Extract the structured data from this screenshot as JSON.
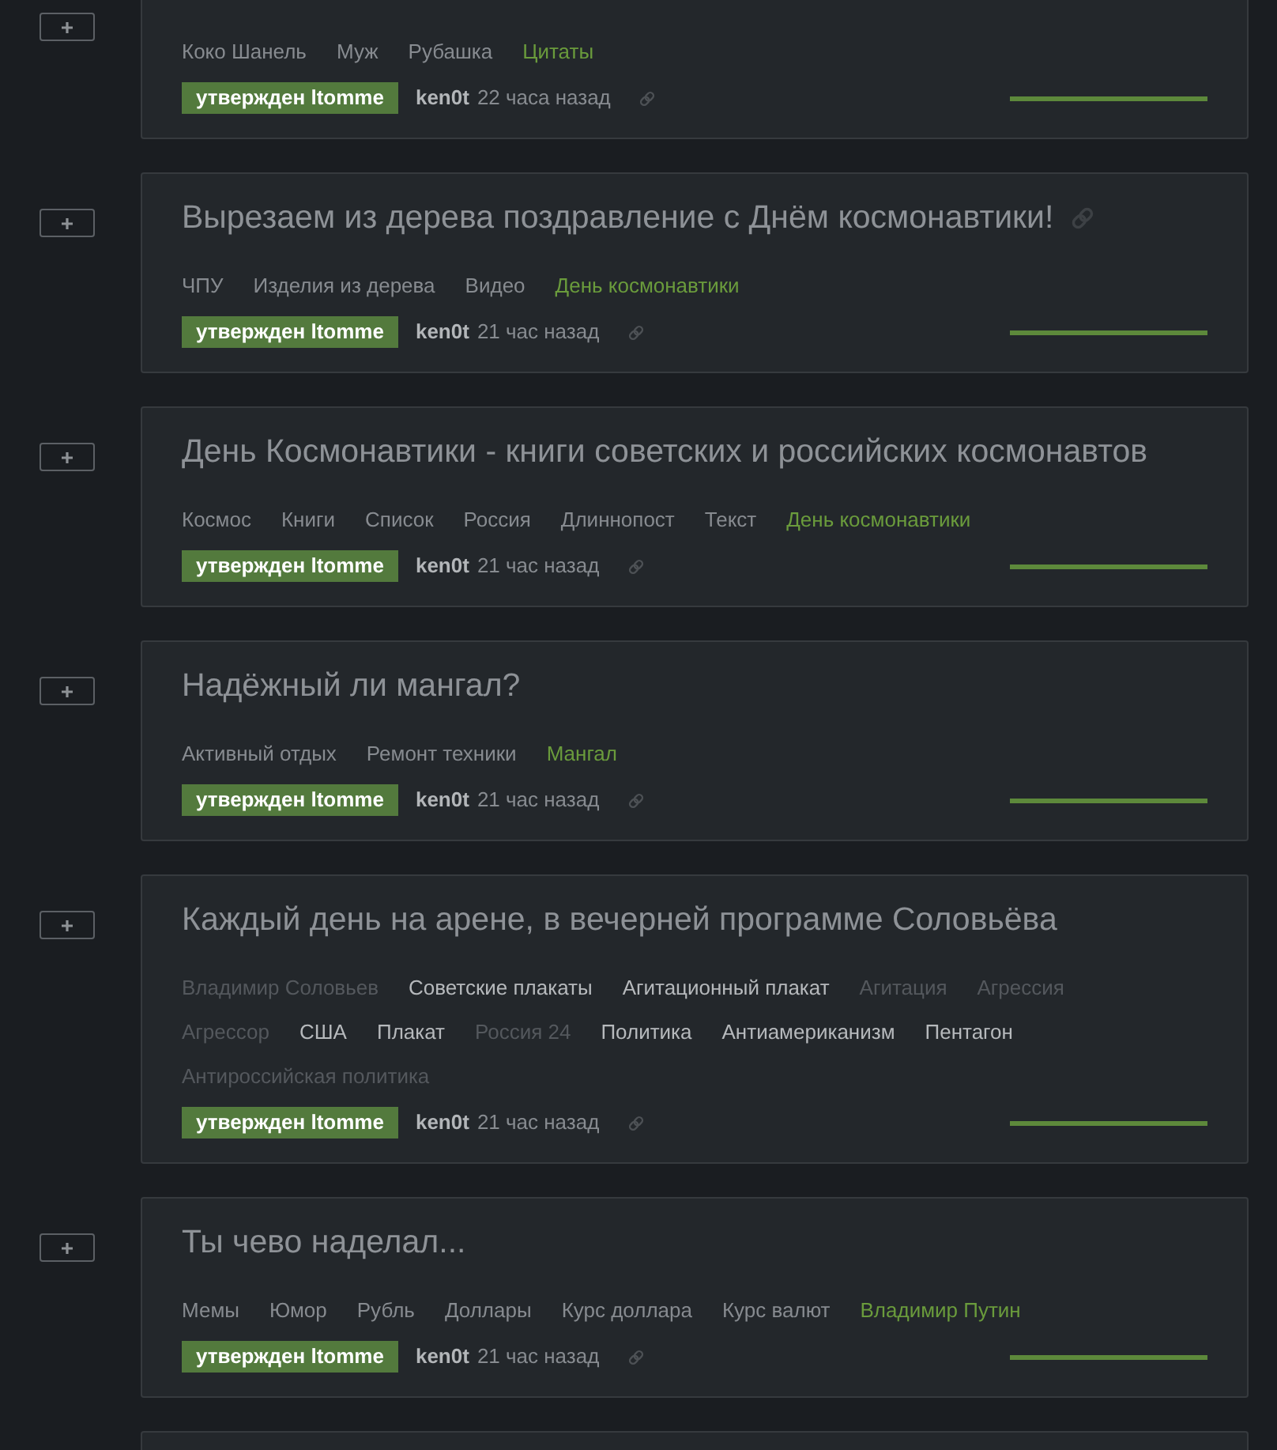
{
  "posts": [
    {
      "title_link_icon": false,
      "tags": [
        {
          "label": "Коко Шанель",
          "kind": "plain"
        },
        {
          "label": "Муж",
          "kind": "plain"
        },
        {
          "label": "Рубашка",
          "kind": "plain"
        },
        {
          "label": "Цитаты",
          "kind": "accent"
        }
      ],
      "badge": "утвержден ltomme",
      "author": "ken0t",
      "time": "22 часа назад",
      "rating": {
        "level": 1
      }
    },
    {
      "title": "Вырезаем из дерева поздравление с Днём космонавтики!",
      "title_link_icon": true,
      "tags": [
        {
          "label": "ЧПУ",
          "kind": "plain"
        },
        {
          "label": "Изделия из дерева",
          "kind": "plain"
        },
        {
          "label": "Видео",
          "kind": "plain"
        },
        {
          "label": "День космонавтики",
          "kind": "accent"
        }
      ],
      "badge": "утвержден ltomme",
      "author": "ken0t",
      "time": "21 час назад",
      "rating": {
        "level": 1
      }
    },
    {
      "title": "День Космонавтики - книги советских и российских космонавтов",
      "title_link_icon": false,
      "tags": [
        {
          "label": "Космос",
          "kind": "plain"
        },
        {
          "label": "Книги",
          "kind": "plain"
        },
        {
          "label": "Список",
          "kind": "plain"
        },
        {
          "label": "Россия",
          "kind": "plain"
        },
        {
          "label": "Длиннопост",
          "kind": "plain"
        },
        {
          "label": "Текст",
          "kind": "plain"
        },
        {
          "label": "День космонавтики",
          "kind": "accent"
        }
      ],
      "badge": "утвержден ltomme",
      "author": "ken0t",
      "time": "21 час назад",
      "rating": {
        "level": 1
      }
    },
    {
      "title": "Надёжный ли мангал?",
      "title_link_icon": false,
      "tags": [
        {
          "label": "Активный отдых",
          "kind": "plain"
        },
        {
          "label": "Ремонт техники",
          "kind": "plain"
        },
        {
          "label": "Мангал",
          "kind": "accent"
        }
      ],
      "badge": "утвержден ltomme",
      "author": "ken0t",
      "time": "21 час назад",
      "rating": {
        "level": 1
      }
    },
    {
      "title": "Каждый день на арене, в вечерней программе Соловьёва",
      "title_link_icon": false,
      "tags": [
        {
          "label": "Владимир Соловьев",
          "kind": "dim"
        },
        {
          "label": "Советские плакаты",
          "kind": "bright"
        },
        {
          "label": "Агитационный плакат",
          "kind": "bright"
        },
        {
          "label": "Агитация",
          "kind": "dim"
        },
        {
          "label": "Агрессия",
          "kind": "dim"
        },
        {
          "label": "Агрессор",
          "kind": "dim"
        },
        {
          "label": "США",
          "kind": "bright"
        },
        {
          "label": "Плакат",
          "kind": "bright"
        },
        {
          "label": "Россия 24",
          "kind": "dim"
        },
        {
          "label": "Политика",
          "kind": "bright"
        },
        {
          "label": "Антиамериканизм",
          "kind": "bright"
        },
        {
          "label": "Пентагон",
          "kind": "bright"
        },
        {
          "label": "Антироссийская политика",
          "kind": "dim"
        }
      ],
      "badge": "утвержден ltomme",
      "author": "ken0t",
      "time": "21 час назад",
      "rating": {
        "level": 1
      }
    },
    {
      "title": "Ты чево наделал...",
      "title_link_icon": false,
      "tags": [
        {
          "label": "Мемы",
          "kind": "plain"
        },
        {
          "label": "Юмор",
          "kind": "plain"
        },
        {
          "label": "Рубль",
          "kind": "plain"
        },
        {
          "label": "Доллары",
          "kind": "plain"
        },
        {
          "label": "Курс доллара",
          "kind": "plain"
        },
        {
          "label": "Курс валют",
          "kind": "plain"
        },
        {
          "label": "Владимир Путин",
          "kind": "accent"
        }
      ],
      "badge": "утвержден ltomme",
      "author": "ken0t",
      "time": "21 час назад",
      "rating": {
        "level": 1
      }
    }
  ]
}
